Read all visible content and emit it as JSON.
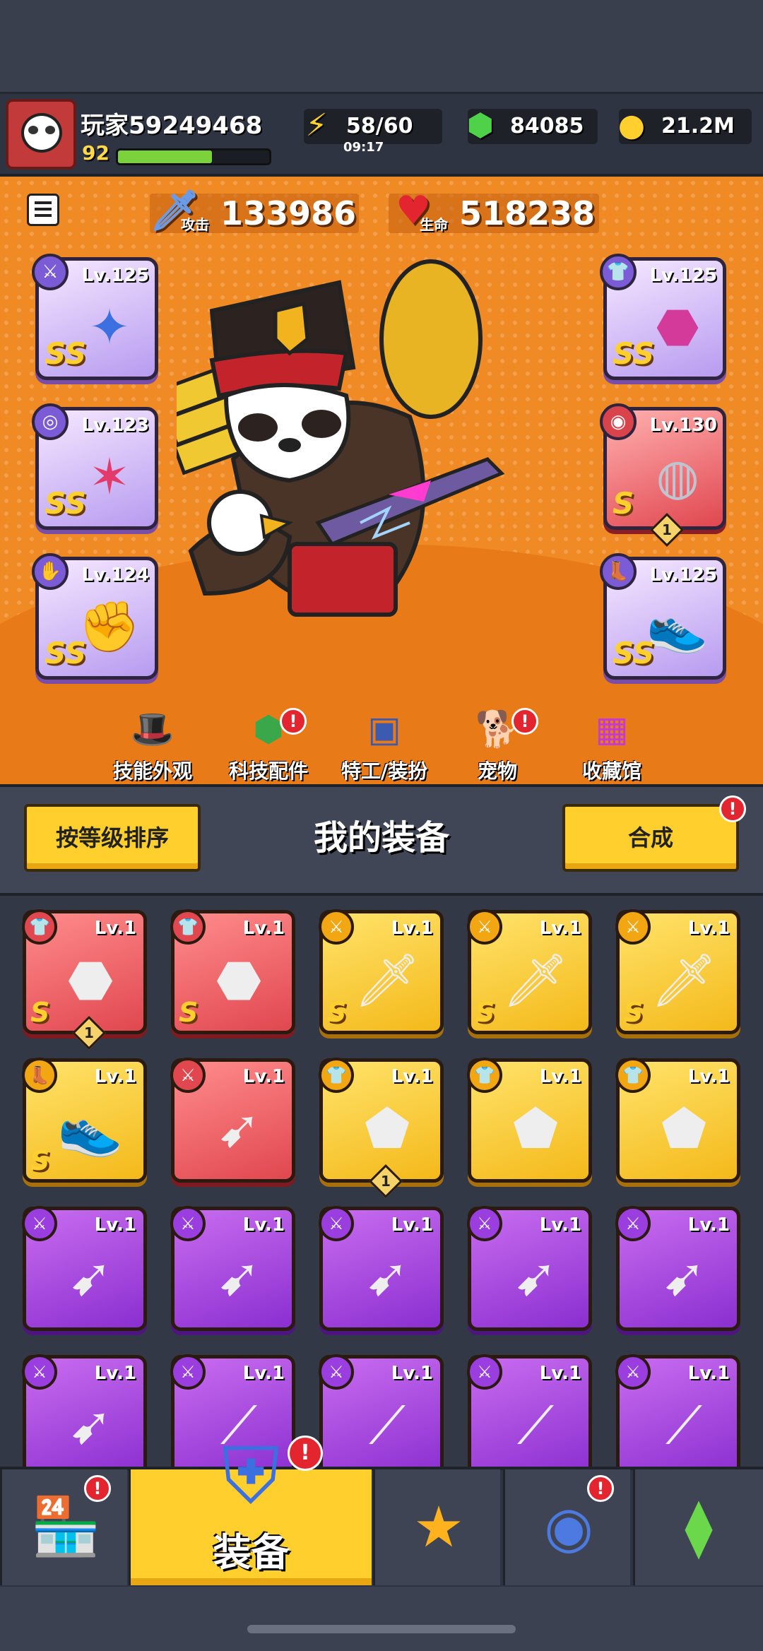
{
  "player": {
    "name": "玩家59249468",
    "level": "92",
    "xp_fraction": 0.62
  },
  "resources": {
    "energy": "58/60",
    "energy_timer": "09:17",
    "gems": "84085",
    "gold": "21.2M"
  },
  "stats": {
    "attack_label": "攻击",
    "attack_value": "133986",
    "hp_label": "生命",
    "hp_value": "518238"
  },
  "equipped": {
    "left": [
      {
        "level": "Lv.125",
        "rank": "SS",
        "badge_icon": "weapon-icon"
      },
      {
        "level": "Lv.123",
        "rank": "SS",
        "badge_icon": "necklace-icon"
      },
      {
        "level": "Lv.124",
        "rank": "SS",
        "badge_icon": "glove-icon"
      }
    ],
    "right": [
      {
        "level": "Lv.125",
        "rank": "SS",
        "badge_icon": "armor-icon"
      },
      {
        "level": "Lv.130",
        "rank": "S",
        "badge_icon": "belt-icon",
        "count": "1"
      },
      {
        "level": "Lv.125",
        "rank": "SS",
        "badge_icon": "boots-icon"
      }
    ]
  },
  "hero_nav": [
    {
      "label": "技能外观",
      "alert": false
    },
    {
      "label": "科技配件",
      "alert": true
    },
    {
      "label": "特工/装扮",
      "alert": false
    },
    {
      "label": "宠物",
      "alert": true
    },
    {
      "label": "收藏馆",
      "alert": false
    }
  ],
  "equipment_section": {
    "sort_button": "按等级排序",
    "title": "我的装备",
    "merge_button": "合成"
  },
  "inventory": [
    [
      {
        "rarity": "red",
        "level": "Lv.1",
        "rank": "S",
        "icon": "armor-icon",
        "count": "1"
      },
      {
        "rarity": "red",
        "level": "Lv.1",
        "rank": "S",
        "icon": "armor-icon"
      },
      {
        "rarity": "yellow",
        "level": "Lv.1",
        "rank": "S",
        "icon": "sword-icon"
      },
      {
        "rarity": "yellow",
        "level": "Lv.1",
        "rank": "S",
        "icon": "sword-icon"
      },
      {
        "rarity": "yellow",
        "level": "Lv.1",
        "rank": "S",
        "icon": "sword-icon"
      }
    ],
    [
      {
        "rarity": "yellow",
        "level": "Lv.1",
        "rank": "S",
        "icon": "boots-icon"
      },
      {
        "rarity": "red",
        "level": "Lv.1",
        "rank": "",
        "icon": "kunai-icon"
      },
      {
        "rarity": "yellow",
        "level": "Lv.1",
        "rank": "",
        "icon": "vest-icon",
        "count": "1"
      },
      {
        "rarity": "yellow",
        "level": "Lv.1",
        "rank": "",
        "icon": "vest-icon"
      },
      {
        "rarity": "yellow",
        "level": "Lv.1",
        "rank": "",
        "icon": "vest-icon"
      }
    ],
    [
      {
        "rarity": "purple",
        "level": "Lv.1",
        "rank": "",
        "icon": "kunai-icon"
      },
      {
        "rarity": "purple",
        "level": "Lv.1",
        "rank": "",
        "icon": "kunai-icon"
      },
      {
        "rarity": "purple",
        "level": "Lv.1",
        "rank": "",
        "icon": "kunai-icon"
      },
      {
        "rarity": "purple",
        "level": "Lv.1",
        "rank": "",
        "icon": "kunai-icon"
      },
      {
        "rarity": "purple",
        "level": "Lv.1",
        "rank": "",
        "icon": "kunai-icon"
      }
    ],
    [
      {
        "rarity": "purple",
        "level": "Lv.1",
        "rank": "",
        "icon": "kunai-icon"
      },
      {
        "rarity": "purple",
        "level": "Lv.1",
        "rank": "",
        "icon": "katana-icon"
      },
      {
        "rarity": "purple",
        "level": "Lv.1",
        "rank": "",
        "icon": "katana-icon"
      },
      {
        "rarity": "purple",
        "level": "Lv.1",
        "rank": "",
        "icon": "katana-icon"
      },
      {
        "rarity": "purple",
        "level": "Lv.1",
        "rank": "",
        "icon": "katana-icon"
      }
    ]
  ],
  "bottom_nav": {
    "active_label": "装备",
    "tabs": [
      {
        "name": "shop-icon",
        "alert": true
      },
      {
        "name": "equipment-icon",
        "alert": true
      },
      {
        "name": "star-swords-icon",
        "alert": false
      },
      {
        "name": "star-ball-icon",
        "alert": true
      },
      {
        "name": "dna-capsule-icon",
        "alert": false
      }
    ]
  },
  "alert_glyph": "!",
  "colors": {
    "hero_bg": "#f08a24",
    "button_yellow": "#ffcf2e",
    "rarity_red": "#e0474f",
    "rarity_yellow": "#f4b91a",
    "rarity_purple": "#8a2fd0",
    "alert_red": "#e3252f"
  }
}
